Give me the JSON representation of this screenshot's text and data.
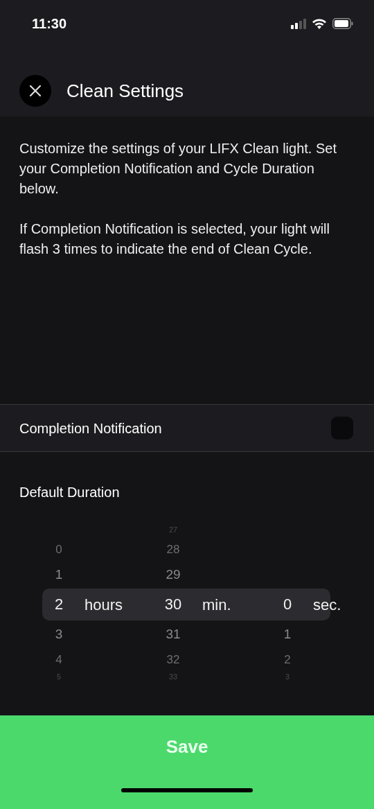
{
  "status_bar": {
    "time": "11:30"
  },
  "header": {
    "title": "Clean Settings"
  },
  "description": [
    "Customize the settings of your LIFX Clean light. Set your Completion Notification and Cycle Duration below.",
    "If Completion Notification is selected, your light will flash 3 times to indicate the end of Clean Cycle."
  ],
  "completion_notification": {
    "label": "Completion Notification",
    "checked": false
  },
  "default_duration": {
    "label": "Default Duration",
    "columns": [
      {
        "unit": "hours",
        "values": [
          {
            "text": "0",
            "selected": false
          },
          {
            "text": "1",
            "selected": false
          },
          {
            "text": "2",
            "selected": true
          },
          {
            "text": "3",
            "selected": false
          },
          {
            "text": "4",
            "selected": false
          },
          {
            "text": "5",
            "selected": false
          }
        ]
      },
      {
        "unit": "min.",
        "values": [
          {
            "text": "27",
            "selected": false
          },
          {
            "text": "28",
            "selected": false
          },
          {
            "text": "29",
            "selected": false
          },
          {
            "text": "30",
            "selected": true
          },
          {
            "text": "31",
            "selected": false
          },
          {
            "text": "32",
            "selected": false
          },
          {
            "text": "33",
            "selected": false
          }
        ]
      },
      {
        "unit": "sec.",
        "values": [
          {
            "text": "0",
            "selected": true
          },
          {
            "text": "1",
            "selected": false
          },
          {
            "text": "2",
            "selected": false
          },
          {
            "text": "3",
            "selected": false
          }
        ]
      }
    ]
  },
  "save_button": {
    "label": "Save"
  }
}
